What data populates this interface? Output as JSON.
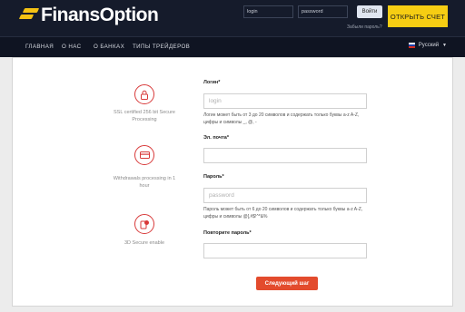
{
  "header": {
    "logo_text": "FinansOption",
    "login_placeholder": "login",
    "password_placeholder": "password",
    "enter_label": "Войти",
    "forgot_label": "Забыли пароль?",
    "open_account_label": "ОТКРЫТЬ СЧЕТ"
  },
  "nav": {
    "items": [
      {
        "label": "ГЛАВНАЯ"
      },
      {
        "label": "О НАС"
      },
      {
        "label": "О БАНКАХ"
      },
      {
        "label": "ТИПЫ ТРЕЙДЕРОВ"
      }
    ],
    "language": "Русский"
  },
  "features": [
    {
      "icon": "lock-icon",
      "text": "SSL certified 256 bit Secure Processing"
    },
    {
      "icon": "credit-card-icon",
      "text": "Withdrawals processing in 1 hour"
    },
    {
      "icon": "secure-3d-icon",
      "text": "3D Secure enable"
    }
  ],
  "form": {
    "login_label": "Логин*",
    "login_placeholder": "login",
    "login_hint": "Логин может быть от 3 до 20 символов и содержать только буквы a-z A-Z, цифры и символы _, @, -",
    "email_label": "Эл. почта*",
    "password_label": "Пароль*",
    "password_placeholder": "password",
    "password_hint": "Пароль может быть от 6 до 20 символов и содержать только буквы a-z A-Z, цифры и символы @[,#$!^*&%",
    "repeat_label": "Повторите пароль*",
    "submit_label": "Следующий шаг"
  },
  "colors": {
    "accent_yellow": "#f6cd13",
    "header_bg": "#151b2b",
    "nav_bg": "#0f1422",
    "submit_red": "#e34b2d",
    "icon_red": "#d83a3a"
  }
}
